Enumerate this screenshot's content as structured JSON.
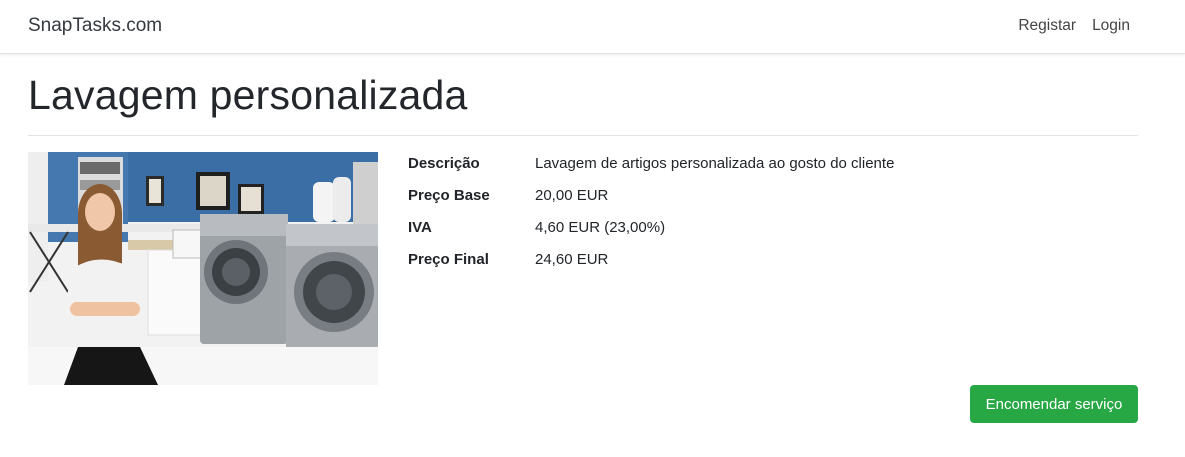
{
  "navbar": {
    "brand": "SnapTasks.com",
    "links": [
      {
        "label": "Registar"
      },
      {
        "label": "Login"
      }
    ]
  },
  "page": {
    "title": "Lavagem personalizada"
  },
  "details": [
    {
      "label": "Descrição",
      "value": "Lavagem de artigos personalizada ao gosto do cliente"
    },
    {
      "label": "Preço Base",
      "value": "20,00 EUR"
    },
    {
      "label": "IVA",
      "value": "4,60 EUR (23,00%)"
    },
    {
      "label": "Preço Final",
      "value": "24,60 EUR"
    }
  ],
  "actions": {
    "order_label": "Encomendar serviço"
  },
  "colors": {
    "accent_green": "#28a745",
    "wall_blue": "#3a6ea5"
  }
}
